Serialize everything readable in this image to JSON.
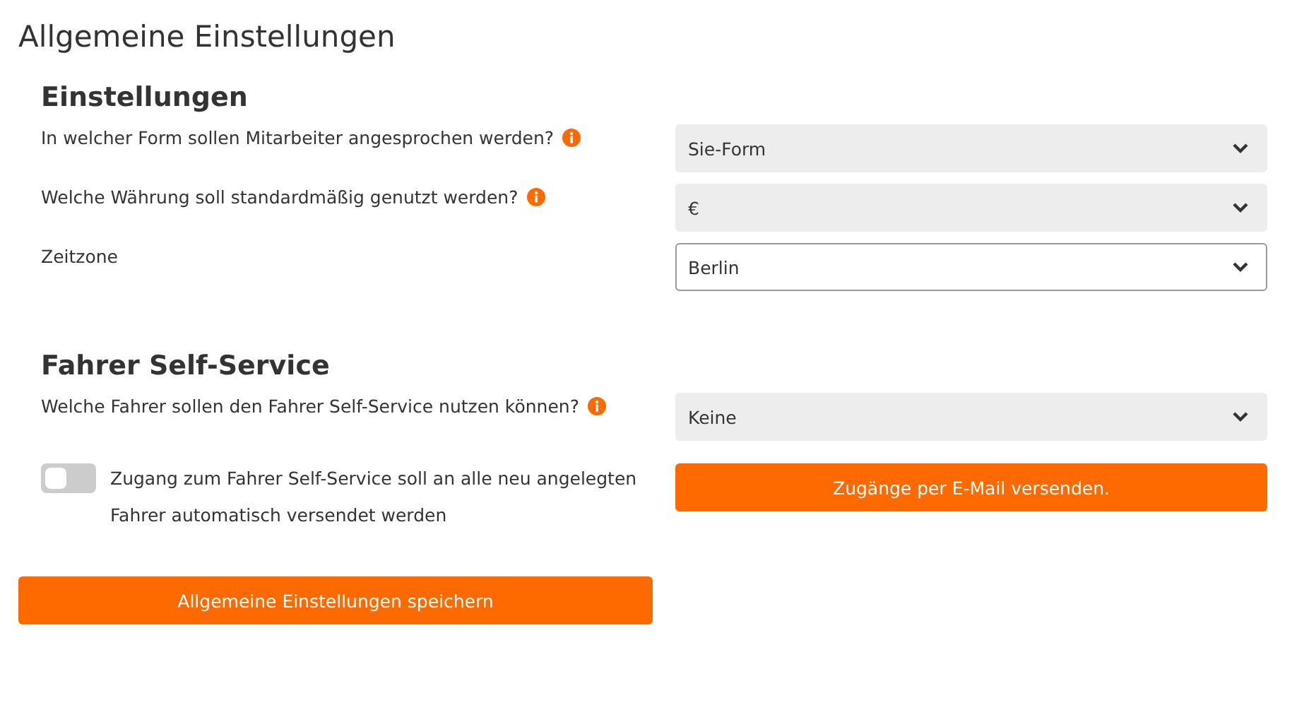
{
  "page_title": "Allgemeine Einstellungen",
  "sections": [
    {
      "heading": "Einstellungen",
      "fields": [
        {
          "label": "In welcher Form sollen Mitarbeiter angesprochen werden?",
          "info": true,
          "value": "Sie-Form",
          "disabled": true
        },
        {
          "label": "Welche Währung soll standardmäßig genutzt werden?",
          "info": true,
          "value": "€",
          "disabled": true
        },
        {
          "label": "Zeitzone",
          "info": false,
          "value": "Berlin",
          "disabled": false
        }
      ]
    },
    {
      "heading": "Fahrer Self-Service",
      "fields": [
        {
          "label": "Welche Fahrer sollen den Fahrer Self-Service nutzen können?",
          "info": true,
          "value": "Keine",
          "disabled": true
        }
      ],
      "toggle": {
        "label": "Zugang zum Fahrer Self-Service soll an alle neu angelegten Fahrer automatisch versendet werden",
        "on": false
      },
      "button": "Zugänge per E-Mail versenden."
    }
  ],
  "save_button": "Allgemeine Einstellungen speichern"
}
